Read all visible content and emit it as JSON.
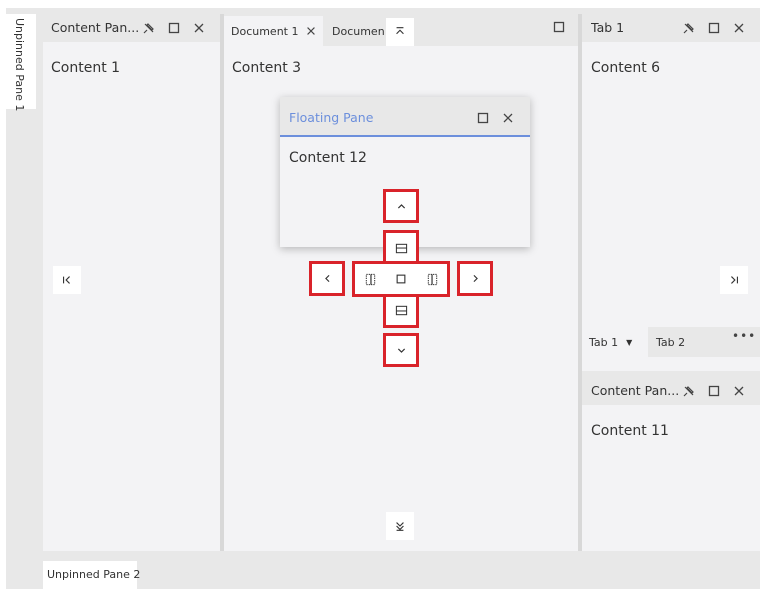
{
  "unpinned_left": {
    "label": "Unpinned Pane 1"
  },
  "unpinned_bottom": {
    "label": "Unpinned Pane 2"
  },
  "left_pane": {
    "title": "Content Pan...",
    "content": "Content 1"
  },
  "documents": {
    "tabs": [
      {
        "label": "Document 1"
      },
      {
        "label": "Document"
      }
    ],
    "content": "Content 3"
  },
  "right_top": {
    "title": "Tab 1",
    "content": "Content 6"
  },
  "right_tabs": [
    {
      "label": "Tab 1"
    },
    {
      "label": "Tab 2"
    }
  ],
  "right_bottom": {
    "title": "Content Pan...",
    "content": "Content 11"
  },
  "floating": {
    "title": "Floating Pane",
    "content": "Content 12"
  },
  "colors": {
    "accent": "#6c8fdc",
    "dock_highlight": "#d9232a",
    "pane_bg": "#f3f3f5",
    "header_bg": "#e8e8e8"
  }
}
